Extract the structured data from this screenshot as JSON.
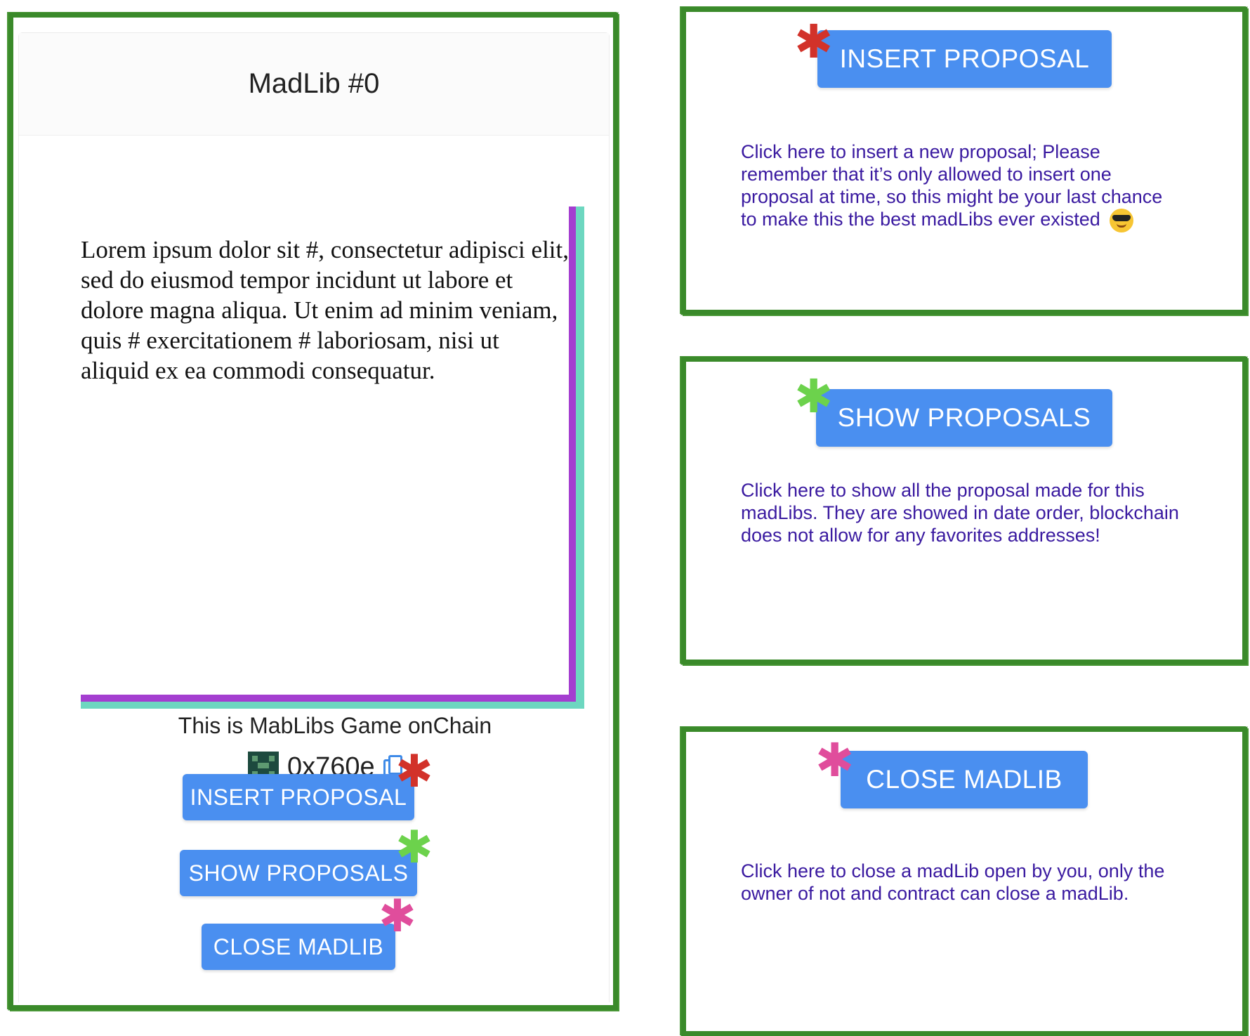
{
  "colors": {
    "frame_green": "#3a8a2a",
    "button_blue": "#4a8ff0",
    "page_purple": "#a43ed0",
    "page_teal": "#6dd7c0",
    "desc_text": "#3a1aa0",
    "asterisk_red": "#d2322a",
    "asterisk_green": "#6cd24c",
    "asterisk_pink": "#e04d9c"
  },
  "madlib": {
    "title": "MadLib #0",
    "text": "Lorem ipsum dolor sit #, consectetur adipisci elit, sed do eiusmod tempor incidunt ut labore et dolore magna aliqua. Ut enim ad minim veniam, quis # exercitationem # laboriosam, nisi ut aliquid ex ea commodi consequatur.",
    "game_text": "This is MabLibs Game onChain",
    "address": "0x760e",
    "icons": {
      "avatar": "identicon-avatar",
      "copy": "copy-icon"
    },
    "buttons": {
      "insert": "INSERT PROPOSAL",
      "show": "SHOW PROPOSALS",
      "close": "CLOSE MADLIB"
    },
    "asterisk": "✱"
  },
  "help": {
    "insert": {
      "button": "INSERT PROPOSAL",
      "text": "Click here to insert a new proposal; Please remember that it’s only allowed to insert one proposal at time, so this might be your last chance to make this the best madLibs ever existed",
      "emoji": "sunglasses-emoji"
    },
    "show": {
      "button": "SHOW PROPOSALS",
      "text": "Click here to show all the proposal made for this madLibs. They are showed in date order, blockchain does not allow for any favorites addresses!"
    },
    "close": {
      "button": "CLOSE MADLIB",
      "text": "Click here to close a madLib open by you, only the owner of not and contract can close a madLib."
    }
  }
}
